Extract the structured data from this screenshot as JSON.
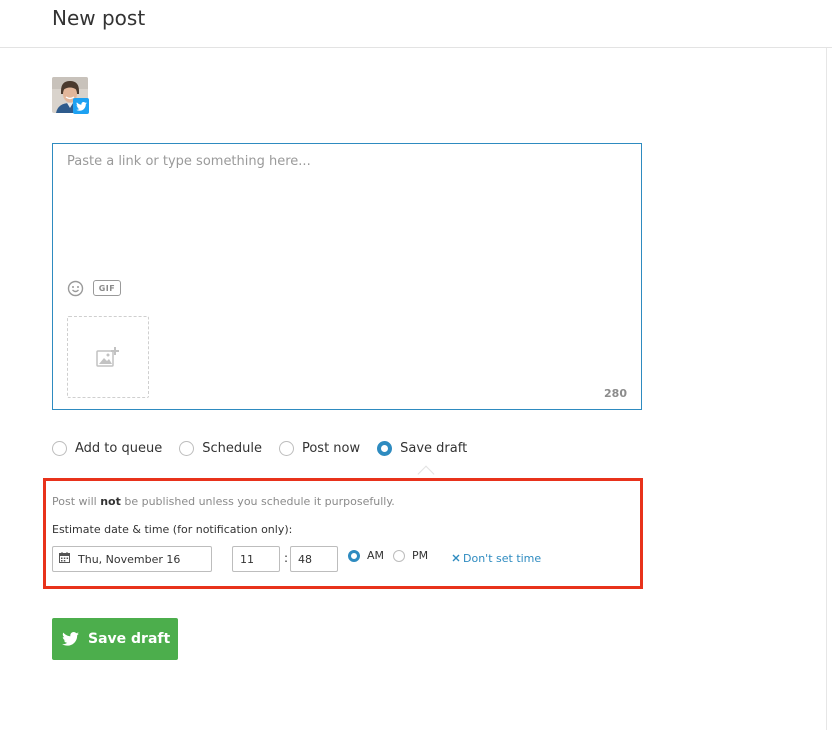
{
  "header": {
    "title": "New post"
  },
  "profile": {
    "avatar": "user-avatar-photo",
    "network": "twitter-icon"
  },
  "composer": {
    "placeholder": "Paste a link or type something here...",
    "value": "",
    "gif_label": "GIF",
    "char_count": "280"
  },
  "post_options": [
    {
      "label": "Add to queue",
      "selected": false
    },
    {
      "label": "Schedule",
      "selected": false
    },
    {
      "label": "Post now",
      "selected": false
    },
    {
      "label": "Save draft",
      "selected": true
    }
  ],
  "draft_panel": {
    "info_prefix": "Post will ",
    "info_emphasis": "not",
    "info_suffix": " be published unless you schedule it purposefully.",
    "estimate_label": "Estimate date & time (for notification only):",
    "date": "Thu, November 16",
    "hour": "11",
    "minute": "48",
    "am_label": "AM",
    "pm_label": "PM",
    "meridiem_selected": "AM",
    "dont_set_label": "Don't set time"
  },
  "actions": {
    "save_label": "Save draft"
  },
  "colors": {
    "accent": "#2e8bc0",
    "primary_button": "#4cae4c",
    "highlight_border": "#e8321b",
    "twitter": "#1da1f2"
  }
}
